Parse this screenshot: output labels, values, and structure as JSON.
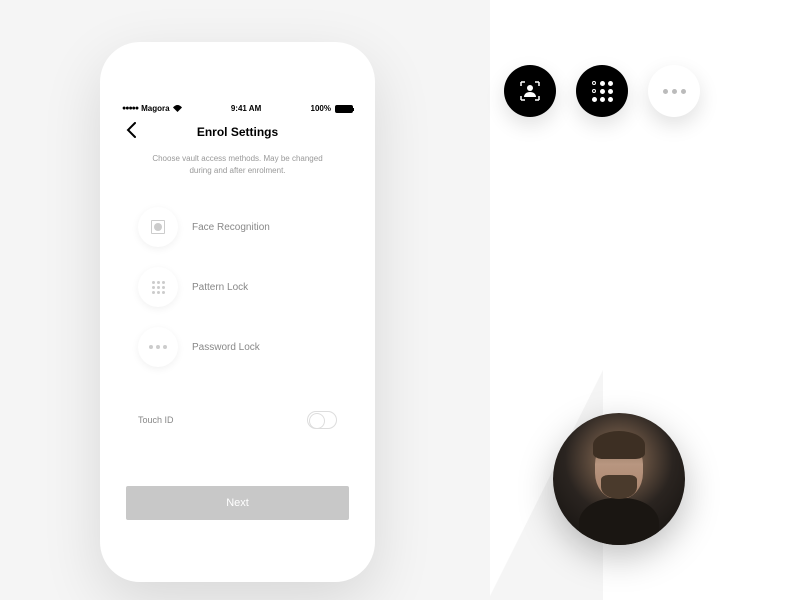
{
  "status_bar": {
    "carrier": "Magora",
    "time": "9:41 AM",
    "battery": "100%"
  },
  "nav": {
    "title": "Enrol Settings"
  },
  "description": "Choose vault access methods. May be changed during and after enrolment.",
  "options": {
    "face": "Face Recognition",
    "pattern": "Pattern Lock",
    "password": "Password Lock"
  },
  "touch_id_label": "Touch ID",
  "next_button": "Next"
}
